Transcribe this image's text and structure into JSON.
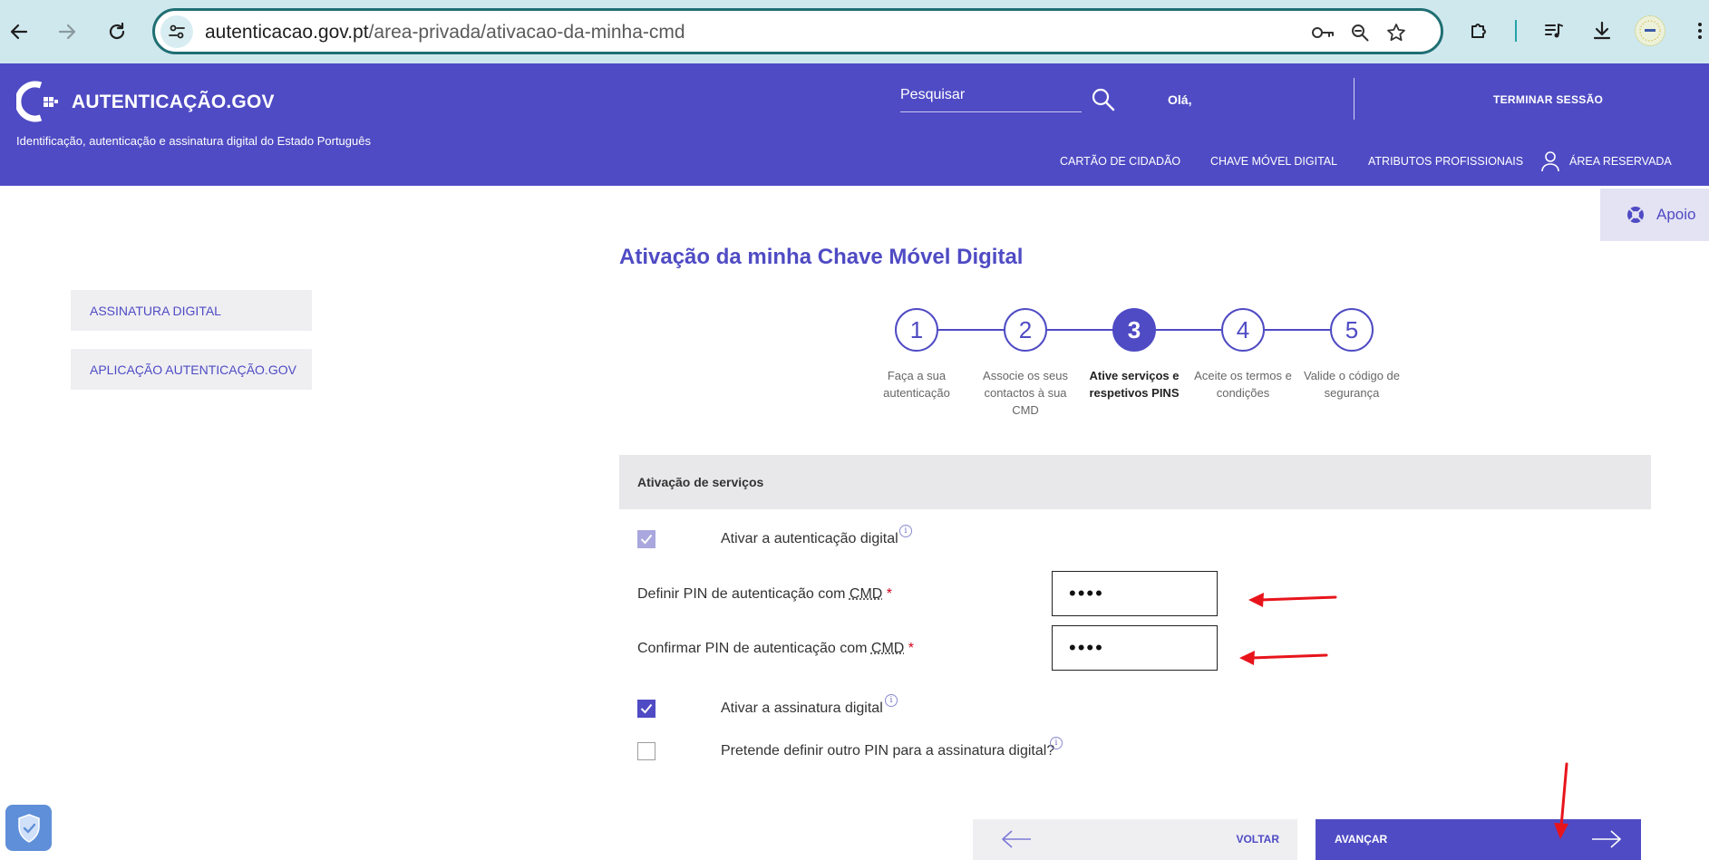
{
  "browser": {
    "url_host": "autenticacao.gov.pt",
    "url_path": "/area-privada/ativacao-da-minha-cmd"
  },
  "header": {
    "logo_text": "AUTENTICAÇÃO.GOV",
    "tagline": "Identificação, autenticação e assinatura digital do Estado Português",
    "search_placeholder": "Pesquisar",
    "greeting": "Olá,",
    "logout_label": "TERMINAR SESSÃO",
    "nav": [
      "CARTÃO DE CIDADÃO",
      "CHAVE MÓVEL DIGITAL",
      "ATRIBUTOS PROFISSIONAIS",
      "ÁREA RESERVADA"
    ]
  },
  "support": {
    "label": "Apoio"
  },
  "sidebar": {
    "items": [
      "ASSINATURA DIGITAL",
      "APLICAÇÃO AUTENTICAÇÃO.GOV"
    ]
  },
  "page": {
    "title": "Ativação da minha Chave Móvel Digital"
  },
  "stepper": {
    "current": 3,
    "steps": [
      {
        "number": "1",
        "label": "Faça a sua autenticação"
      },
      {
        "number": "2",
        "label": "Associe os seus contactos à sua CMD"
      },
      {
        "number": "3",
        "label": "Ative serviços e respetivos PINS"
      },
      {
        "number": "4",
        "label": "Aceite os termos e condições"
      },
      {
        "number": "5",
        "label": "Valide o código de segurança"
      }
    ]
  },
  "services": {
    "heading": "Ativação de serviços",
    "auth_label": "Ativar a autenticação digital",
    "auth_checked": true,
    "pin_label": "Definir PIN de autenticação com",
    "confirm_pin_label": "Confirmar PIN de autenticação com",
    "abbr": "CMD",
    "required_mark": "*",
    "pin_value": "••••",
    "confirm_pin_value": "••••",
    "sign_label": "Ativar a assinatura digital",
    "sign_checked": true,
    "other_pin_label": "Pretende definir outro PIN para a assinatura digital?",
    "other_pin_checked": false,
    "info_glyph": "i"
  },
  "actions": {
    "back_label": "VOLTAR",
    "next_label": "AVANÇAR"
  },
  "colors": {
    "brand": "#4f4bc4",
    "annotation": "#e8141b"
  }
}
